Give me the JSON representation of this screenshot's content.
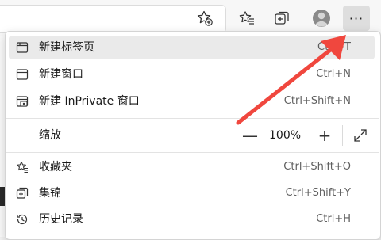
{
  "toolbar": {
    "icons": [
      "add-favorite-icon",
      "favorites-icon",
      "collections-icon",
      "profile-icon"
    ],
    "more_label": "···"
  },
  "menu": {
    "items_top": [
      {
        "label": "新建标签页",
        "shortcut": "Ctrl+T",
        "icon": "new-tab-icon"
      },
      {
        "label": "新建窗口",
        "shortcut": "Ctrl+N",
        "icon": "new-window-icon"
      },
      {
        "label": "新建 InPrivate 窗口",
        "shortcut": "Ctrl+Shift+N",
        "icon": "inprivate-window-icon"
      }
    ],
    "zoom": {
      "label": "缩放",
      "minus": "—",
      "value": "100%",
      "plus": "+"
    },
    "items_bottom": [
      {
        "label": "收藏夹",
        "shortcut": "Ctrl+Shift+O",
        "icon": "favorites-icon"
      },
      {
        "label": "集锦",
        "shortcut": "Ctrl+Shift+Y",
        "icon": "collections-icon"
      },
      {
        "label": "历史记录",
        "shortcut": "Ctrl+H",
        "icon": "history-icon"
      }
    ]
  },
  "colors": {
    "annotation_arrow": "#f0473e",
    "highlight": "#eaeaea"
  }
}
